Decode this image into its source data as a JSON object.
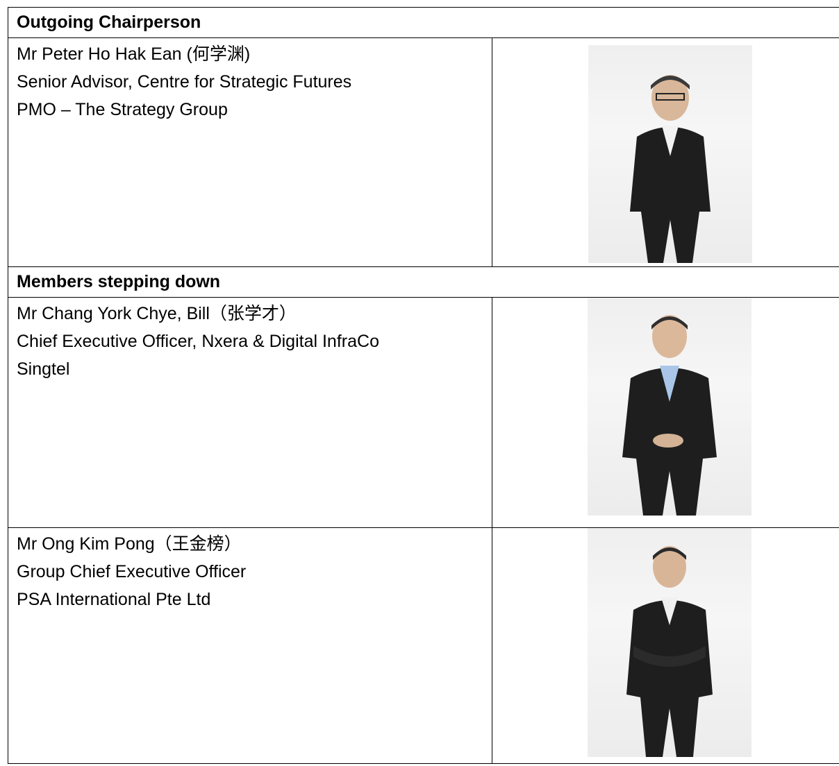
{
  "sections": {
    "outgoing_header": "Outgoing Chairperson",
    "members_header": "Members stepping down"
  },
  "people": [
    {
      "name": "Mr Peter Ho Hak Ean (何学渊)",
      "title": "Senior Advisor, Centre for Strategic Futures",
      "organisation": "PMO – The Strategy Group"
    },
    {
      "name": "Mr Chang York Chye, Bill（张学才）",
      "title": "Chief Executive Officer, Nxera & Digital InfraCo",
      "organisation": "Singtel"
    },
    {
      "name": "Mr Ong Kim Pong（王金榜）",
      "title": "Group Chief Executive Officer",
      "organisation": "PSA International Pte Ltd"
    }
  ],
  "colors": {
    "border": "#000000",
    "photo_background": "#efefef",
    "suit": "#1e1e1e"
  }
}
